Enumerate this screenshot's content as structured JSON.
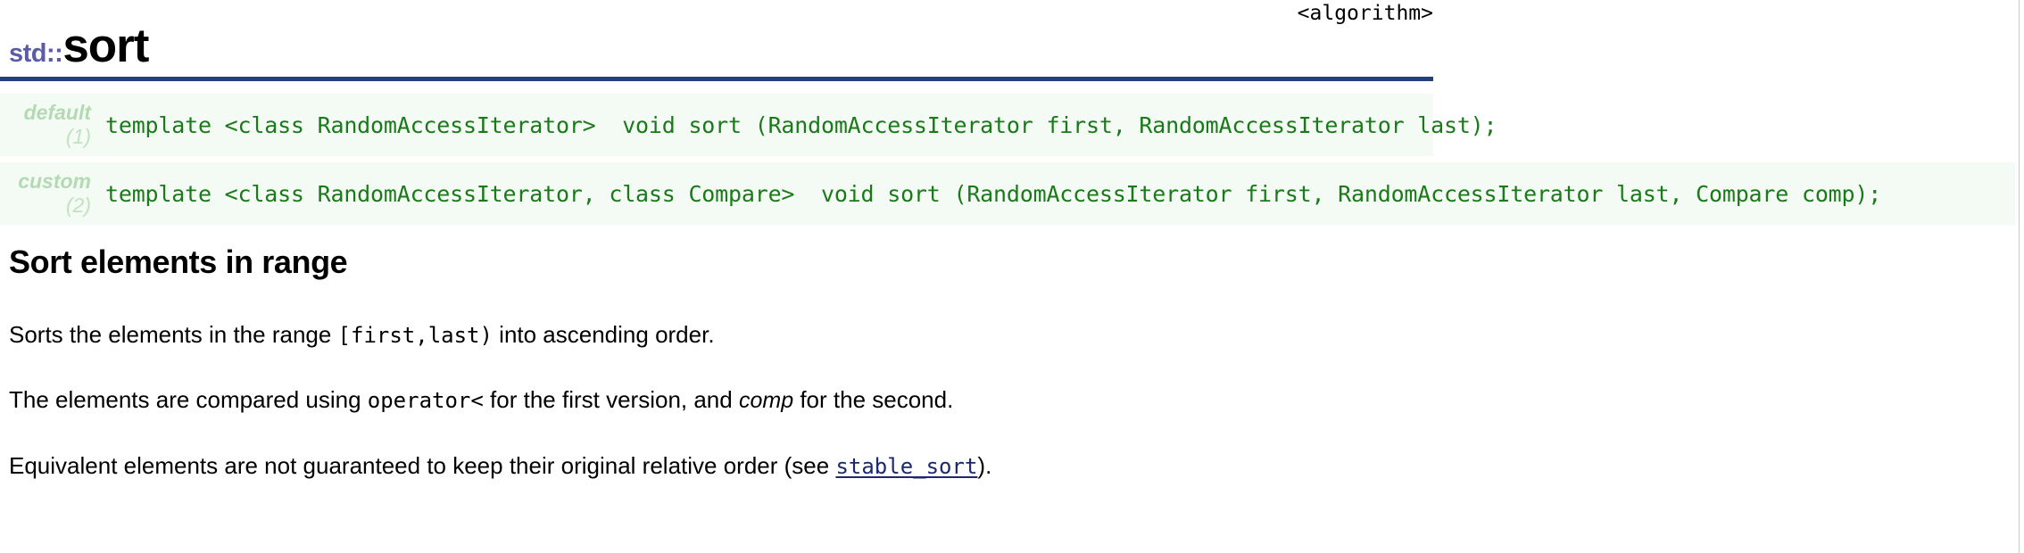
{
  "header": {
    "namespace": "std::",
    "function": "sort",
    "include": "<algorithm>",
    "rule_color": "#24407a",
    "namespace_color": "#5b5ba8"
  },
  "prototypes": {
    "rows": [
      {
        "kind": "default",
        "number": "(1)",
        "code": "template <class RandomAccessIterator>  void sort (RandomAccessIterator first, RandomAccessIterator last);"
      },
      {
        "kind": "custom",
        "number": "(2)",
        "code": "template <class RandomAccessIterator, class Compare>  void sort (RandomAccessIterator first, RandomAccessIterator last, Compare comp);"
      }
    ],
    "background_color": "#f4fbf4",
    "code_color": "#1a7a1a",
    "label_color": "#b3dab3"
  },
  "description": {
    "heading": "Sort elements in range",
    "paragraph_1": {
      "before": "Sorts the elements in the range ",
      "code": "[first,last)",
      "after": " into ascending order."
    },
    "paragraph_2": {
      "before": "The elements are compared using ",
      "code": "operator<",
      "middle": " for the first version, and ",
      "italic": "comp",
      "after": " for the second."
    },
    "paragraph_3": {
      "before": "Equivalent elements are not guaranteed to keep their original relative order (see ",
      "link": "stable_sort",
      "after": ")."
    },
    "link_color": "#1a2a6c"
  }
}
